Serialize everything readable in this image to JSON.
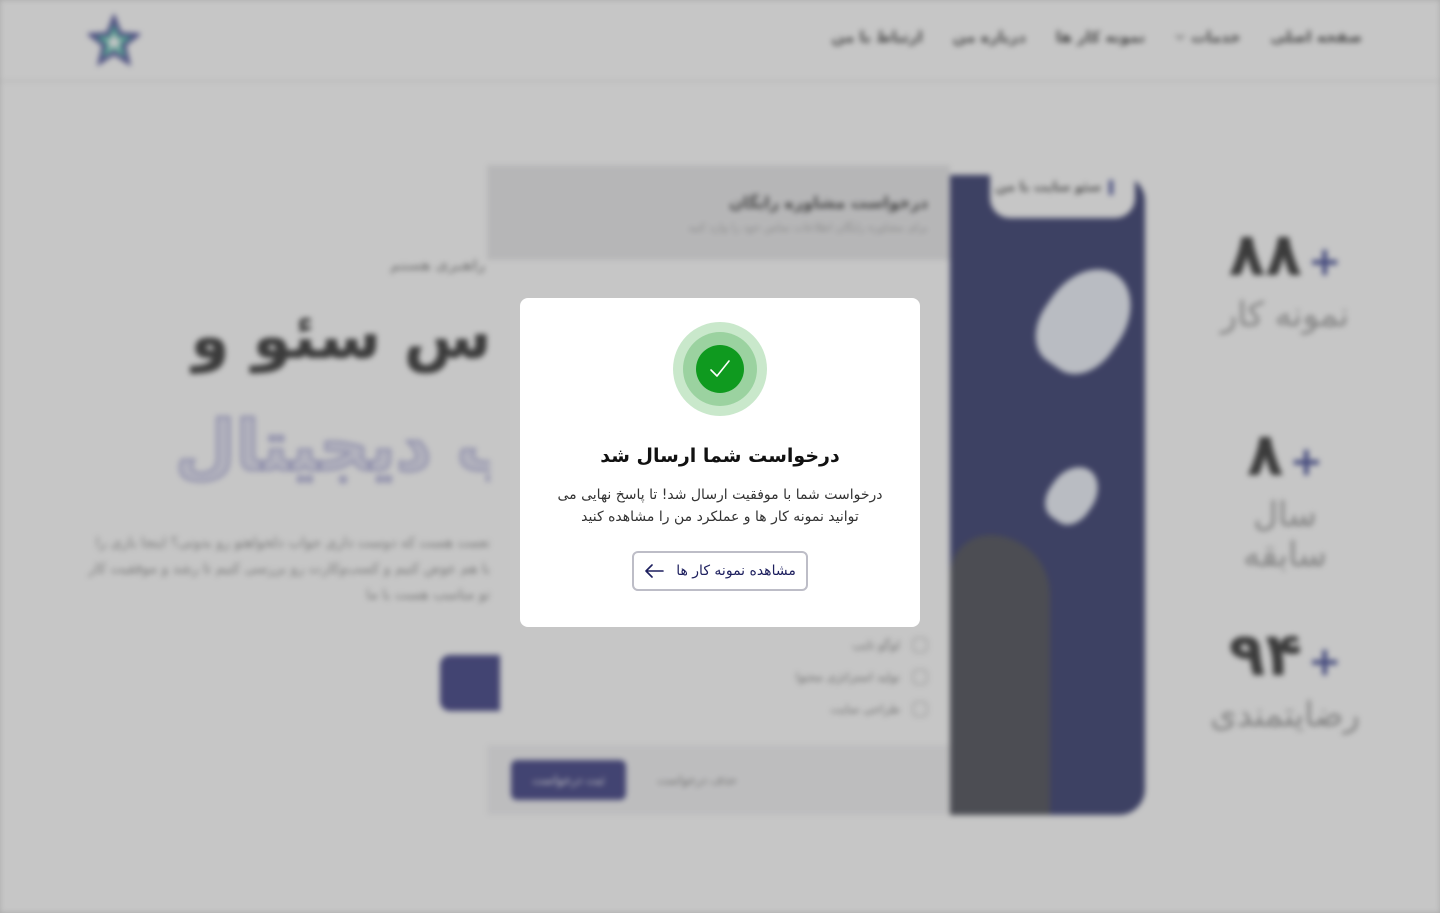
{
  "nav": {
    "items": [
      {
        "label": "صفحه اصلی"
      },
      {
        "label": "خدمات"
      },
      {
        "label": "نمونه کار ها"
      },
      {
        "label": "درباره من"
      },
      {
        "label": "ارتباط با من"
      }
    ]
  },
  "stats": [
    {
      "value": "۸۸",
      "plus": "+",
      "label": "نمونه کار"
    },
    {
      "value": "۸",
      "plus": "+",
      "label": "سال سابقه"
    },
    {
      "value": "۹۴",
      "plus": "+",
      "label": "رضایتمندی"
    }
  ],
  "phone": {
    "tab_label": "سئو سایت با من"
  },
  "form": {
    "title": "درخواست مشاوره رایگان",
    "subtitle": "برای مشاوره رایگان اطلاعات تماس خود را وارد کنید",
    "options": [
      "لوگو تایپ",
      "تولید استراتژی محتوا",
      "طراحی سایت"
    ],
    "submit_label": "ثبت درخواست",
    "cancel_label": "حذف درخواست"
  },
  "hero": {
    "small": "راهبری هستم",
    "title_line1": "کارشناس سئو و",
    "title_line2": "بازاریاب دیجیتال",
    "paragraph": "نعمت هست که دوست داری جواب دلخواهتو رو بدونی؟ اینجا بازی را با هم عوض کنیم و کسب‌وکارت رو بررسی کنیم تا رشد و موفقیت کار تو مناسب هست با ما"
  },
  "modal": {
    "title": "درخواست شما ارسال شد",
    "message": "درخواست شما با موفقیت ارسال شد! تا پاسخ نهایی می توانید نمونه کار ها و عملکرد من را مشاهده کنید",
    "button_label": "مشاهده نمونه کار ها",
    "success_color": "#0f9a1f",
    "icons": {
      "status": "checkmark-icon",
      "button": "arrow-left-icon"
    }
  }
}
